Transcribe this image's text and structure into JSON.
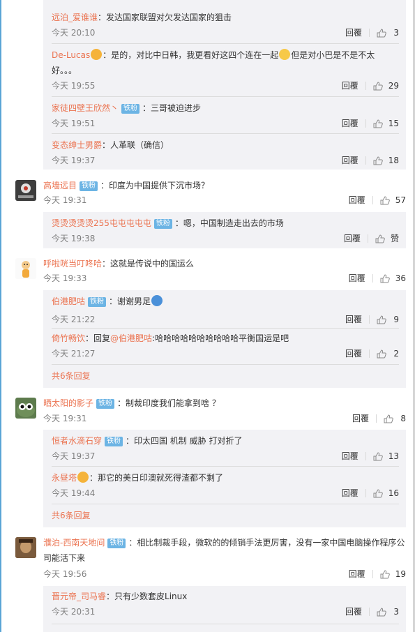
{
  "comments": [
    {
      "user": "高墙远目",
      "badge": "铁粉",
      "text": "：印度为中国提供下沉市场？",
      "time": "今天 19:31",
      "reply": "回覆",
      "likes": "57"
    },
    {
      "user": "呼啦咣当叮咚哈",
      "text": "：这就是传说中的国运么",
      "time": "今天 19:33",
      "reply": "回覆",
      "likes": "36"
    },
    {
      "user": "晒太阳的影子",
      "badge": "铁粉",
      "text": "：制裁印度我们能拿到啥 ？",
      "time": "今天 19:31",
      "reply": "回覆",
      "likes": "8"
    },
    {
      "user": "濮泊-西南天地间",
      "badge": "铁粉",
      "text": "：相比制裁手段，微软的的倾销手法更厉害，没有一家中国电脑操作程序公司能活下来",
      "time": "今天 19:56",
      "reply": "回覆",
      "likes": "19"
    }
  ],
  "subs": [
    {
      "user": "远泊_爱谁谁",
      "text": "：发达国家联盟对欠发达国家的狙击",
      "time": "今天 20:10",
      "reply": "回覆",
      "likes": "3"
    },
    {
      "user": "De-Lucas",
      "text_a": "：是的，对比中日韩，我更看好这四个连在一起",
      "text_b": "但是对小巴是不是不太好。。。",
      "time": "今天 19:55",
      "reply": "回覆",
      "likes": "29"
    },
    {
      "user": "家徒四壁王欣然丶",
      "badge": "铁粉",
      "text": "：三哥被迫进步",
      "time": "今天 19:51",
      "reply": "回覆",
      "likes": "15"
    },
    {
      "user": "变态绅士男爵",
      "text": "：人革联（确信）",
      "time": "今天 19:37",
      "reply": "回覆",
      "likes": "18"
    },
    {
      "user": "烫烫烫烫烫255屯屯屯屯屯",
      "badge": "铁粉",
      "text": "：嗯，中国制造走出去的市场",
      "time": "今天 19:38",
      "reply": "回覆",
      "likes": "赞"
    },
    {
      "user": "伯港肥咕",
      "badge": "铁粉",
      "text": "：谢谢男足",
      "time": "今天 21:22",
      "reply": "回覆",
      "likes": "9"
    },
    {
      "user": "倚竹畅饮",
      "text_a": "：回复",
      "mention": "@伯港肥咕",
      "text_b": ":哈哈哈哈哈哈哈哈哈哈平衡国运是吧",
      "time": "今天 21:27",
      "reply": "回覆",
      "likes": "2"
    },
    {
      "user": "恒者水滴石穿",
      "badge": "铁粉",
      "text": "：印太四国 机制 威胁 打对折了",
      "time": "今天 19:37",
      "reply": "回覆",
      "likes": "13"
    },
    {
      "user": "永昼塔",
      "text": "：那它的美日印澳就死得渣都不剩了",
      "time": "今天 19:44",
      "reply": "回覆",
      "likes": "16"
    },
    {
      "user": "晋元帝_司马睿",
      "text": "：只有少数套皮Linux",
      "time": "今天 20:31",
      "reply": "回覆",
      "likes": "3"
    }
  ],
  "more_replies": [
    "共6条回复",
    "共6条回复"
  ],
  "colors": {
    "username": "#eb7350",
    "badge": "#6cb4e4",
    "sub_bg": "#f2f2f5",
    "meta": "#808080"
  }
}
